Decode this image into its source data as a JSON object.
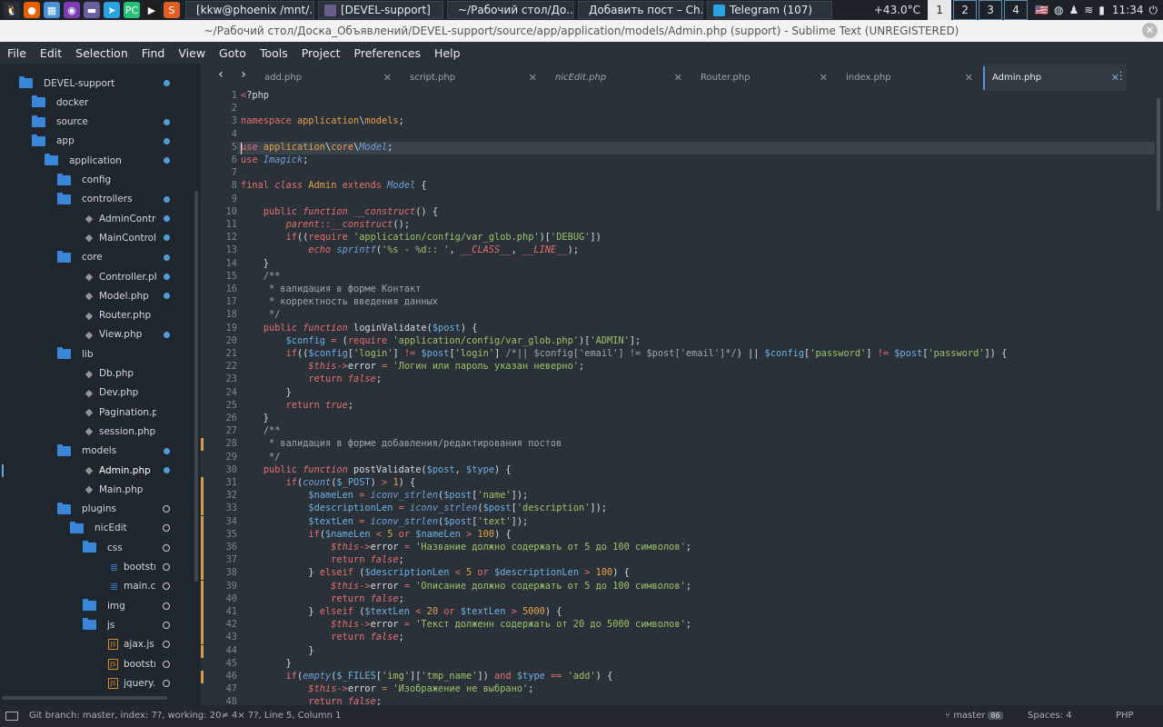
{
  "taskbar": {
    "tasks": [
      {
        "label": "[kkw@phoenix /mnt/...",
        "color": "#1e1e1e"
      },
      {
        "label": "[DEVEL-support]",
        "color": "#6d5d8a"
      },
      {
        "label": "~/Рабочий стол/До...",
        "color": "#8c8c8c"
      },
      {
        "label": "Добавить пост – Ch...",
        "color": "#4a8ad8"
      },
      {
        "label": "Telegram (107)",
        "color": "#2aa3e0"
      }
    ],
    "temperature": "+43.0°C",
    "workspaces": [
      "1",
      "2",
      "3",
      "4"
    ],
    "time": "11:34",
    "launcher_icons": [
      "linux-tux-icon",
      "firefox-icon",
      "files-icon",
      "eye-icon",
      "folder-icon",
      "telegram-icon",
      "pycharm-icon",
      "terminal-icon",
      "sublime-icon"
    ],
    "tray_icons": [
      "us-flag-icon",
      "network-globe-icon",
      "user-icon",
      "wifi-icon",
      "battery-icon",
      "power-icon"
    ]
  },
  "window": {
    "title": "~/Рабочий стол/Доска_Объявлений/DEVEL-support/source/app/application/models/Admin.php (support) - Sublime Text (UNREGISTERED)"
  },
  "menu": [
    "File",
    "Edit",
    "Selection",
    "Find",
    "View",
    "Goto",
    "Tools",
    "Project",
    "Preferences",
    "Help"
  ],
  "sidebar": {
    "items": [
      {
        "label": "DEVEL-support",
        "type": "folder",
        "level": 0,
        "dot": "filled"
      },
      {
        "label": "docker",
        "type": "folder",
        "level": 1,
        "dot": "none"
      },
      {
        "label": "source",
        "type": "folder",
        "level": 1,
        "dot": "filled"
      },
      {
        "label": "app",
        "type": "folder",
        "level": 2,
        "dot": "filled"
      },
      {
        "label": "application",
        "type": "folder",
        "level": 3,
        "dot": "filled"
      },
      {
        "label": "config",
        "type": "folder",
        "level": 4,
        "dot": "none"
      },
      {
        "label": "controllers",
        "type": "folder",
        "level": 4,
        "dot": "filled"
      },
      {
        "label": "AdminControlle",
        "type": "php",
        "level": 5,
        "dot": "filled"
      },
      {
        "label": "MainController.",
        "type": "php",
        "level": 5,
        "dot": "filled"
      },
      {
        "label": "core",
        "type": "folder",
        "level": 4,
        "dot": "filled"
      },
      {
        "label": "Controller.php",
        "type": "php",
        "level": 5,
        "dot": "filled"
      },
      {
        "label": "Model.php",
        "type": "php",
        "level": 5,
        "dot": "filled"
      },
      {
        "label": "Router.php",
        "type": "php",
        "level": 5,
        "dot": "none"
      },
      {
        "label": "View.php",
        "type": "php",
        "level": 5,
        "dot": "filled"
      },
      {
        "label": "lib",
        "type": "folder",
        "level": 4,
        "dot": "none"
      },
      {
        "label": "Db.php",
        "type": "php",
        "level": 5,
        "dot": "none"
      },
      {
        "label": "Dev.php",
        "type": "php",
        "level": 5,
        "dot": "none"
      },
      {
        "label": "Pagination.php",
        "type": "php",
        "level": 5,
        "dot": "none"
      },
      {
        "label": "session.php",
        "type": "php",
        "level": 5,
        "dot": "none"
      },
      {
        "label": "models",
        "type": "folder",
        "level": 4,
        "dot": "filled"
      },
      {
        "label": "Admin.php",
        "type": "php",
        "level": 5,
        "dot": "filled",
        "selected": true
      },
      {
        "label": "Main.php",
        "type": "php",
        "level": 5,
        "dot": "none"
      },
      {
        "label": "plugins",
        "type": "folder",
        "level": 4,
        "dot": "hollow"
      },
      {
        "label": "nicEdit",
        "type": "folder",
        "level": 5,
        "dot": "hollow"
      },
      {
        "label": "css",
        "type": "folder",
        "level": 6,
        "dot": "hollow"
      },
      {
        "label": "bootstra",
        "type": "css",
        "level": 7,
        "dot": "hollow"
      },
      {
        "label": "main.css",
        "type": "css",
        "level": 7,
        "dot": "hollow"
      },
      {
        "label": "img",
        "type": "folder",
        "level": 6,
        "dot": "hollow"
      },
      {
        "label": "js",
        "type": "folder",
        "level": 6,
        "dot": "hollow"
      },
      {
        "label": "ajax.js",
        "type": "js",
        "level": 7,
        "dot": "hollow"
      },
      {
        "label": "bootstra",
        "type": "js",
        "level": 7,
        "dot": "hollow"
      },
      {
        "label": "jquery.m",
        "type": "js",
        "level": 7,
        "dot": "hollow"
      }
    ]
  },
  "tabs": [
    {
      "label": "add.php",
      "italic": false,
      "active": false
    },
    {
      "label": "script.php",
      "italic": false,
      "active": false
    },
    {
      "label": "nicEdit.php",
      "italic": true,
      "active": false
    },
    {
      "label": "Router.php",
      "italic": false,
      "active": false
    },
    {
      "label": "index.php",
      "italic": false,
      "active": false
    },
    {
      "label": "Admin.php",
      "italic": false,
      "active": true
    }
  ],
  "editor": {
    "highlighted_line": 5,
    "gutter_modified_lines": [
      28,
      31,
      32,
      33,
      34,
      35,
      36,
      37,
      38,
      39,
      40,
      41,
      42,
      43,
      44,
      46
    ],
    "lines": [
      "<?php",
      "",
      "namespace application\\models;",
      "",
      "use application\\core\\Model;",
      "use Imagick;",
      "",
      "final class Admin extends Model {",
      "",
      "    public function __construct() {",
      "        parent::__construct();",
      "        if((require 'application/config/var_glob.php')['DEBUG'])",
      "            echo sprintf('%s - %d:: ', __CLASS__, __LINE__);",
      "    }",
      "    /**",
      "     * валидация в форме Контакт",
      "     * корректность введения данных",
      "     */",
      "    public function loginValidate($post) {",
      "        $config = (require 'application/config/var_glob.php')['ADMIN'];",
      "        if(($config['login'] != $post['login'] /*|| $config['email'] != $post['email']*/) || $config['password'] != $post['password']) {",
      "            $this->error = 'Логин или пароль указан неверно';",
      "            return false;",
      "        }",
      "        return true;",
      "    }",
      "    /**",
      "     * валидация в форме добавления/редактирования постов",
      "     */",
      "    public function postValidate($post, $type) {",
      "        if(count($_POST) > 1) {",
      "            $nameLen = iconv_strlen($post['name']);",
      "            $descriptionLen = iconv_strlen($post['description']);",
      "            $textLen = iconv_strlen($post['text']);",
      "            if($nameLen < 5 or $nameLen > 100) {",
      "                $this->error = 'Название должно содержать от 5 до 100 символов';",
      "                return false;",
      "            } elseif ($descriptionLen < 5 or $descriptionLen > 100) {",
      "                $this->error = 'Описание должно содержать от 5 до 100 символов';",
      "                return false;",
      "            } elseif ($textLen < 20 or $textLen > 5000) {",
      "                $this->error = 'Текст долженн содержать от 20 до 5000 символов';",
      "                return false;",
      "            }",
      "        }",
      "        if(empty($_FILES['img']['tmp_name']) and $type == 'add') {",
      "            $this->error = 'Изображение не выбрано';",
      "            return false;"
    ]
  },
  "statusbar": {
    "left": "Git branch: master, index: 7?, working: 20≠ 4× 7?, Line 5, Column 1",
    "branch": "master",
    "branch_badge": "86",
    "spaces": "Spaces: 4",
    "syntax": "PHP"
  }
}
